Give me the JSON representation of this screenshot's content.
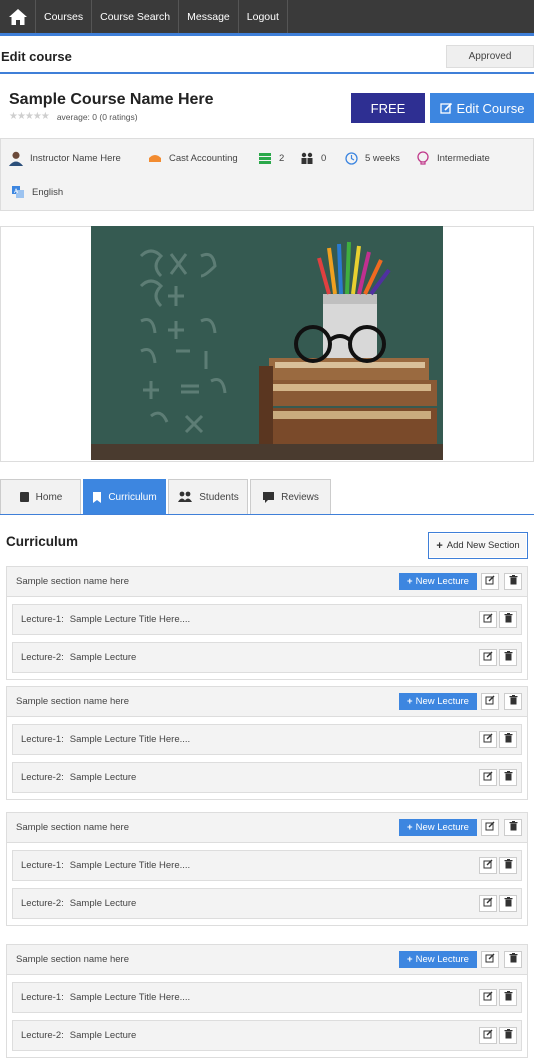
{
  "nav": {
    "home_icon": "home-icon",
    "items": [
      "Courses",
      "Course Search",
      "Message",
      "Logout"
    ]
  },
  "header": {
    "title": "Edit course",
    "status": "Approved"
  },
  "course": {
    "title": "Sample Course Name Here",
    "rating_text": "average: 0 (0 ratings)",
    "rating_value": 0,
    "free_label": "FREE",
    "edit_label": "Edit Course"
  },
  "meta": {
    "instructor": "Instructor Name Here",
    "category": "Cast Accounting",
    "lessons": "2",
    "students": "0",
    "duration": "5 weeks",
    "level": "Intermediate",
    "language": "English"
  },
  "tabs": [
    "Home",
    "Curriculum",
    "Students",
    "Reviews"
  ],
  "curriculum": {
    "title": "Curriculum",
    "add_section_label": "Add New Section",
    "new_lecture_label": "New Lecture",
    "sections": [
      {
        "name": "Sample section name here",
        "lectures": [
          {
            "num": "Lecture-1:",
            "title": "Sample Lecture Title Here...."
          },
          {
            "num": "Lecture-2:",
            "title": "Sample Lecture"
          }
        ]
      },
      {
        "name": "Sample section name here",
        "lectures": [
          {
            "num": "Lecture-1:",
            "title": "Sample Lecture Title Here...."
          },
          {
            "num": "Lecture-2:",
            "title": "Sample Lecture"
          }
        ]
      },
      {
        "name": "Sample section name here",
        "lectures": [
          {
            "num": "Lecture-1:",
            "title": "Sample Lecture Title Here...."
          },
          {
            "num": "Lecture-2:",
            "title": "Sample Lecture"
          }
        ]
      },
      {
        "name": "Sample section name here",
        "lectures": [
          {
            "num": "Lecture-1:",
            "title": "Sample Lecture Title Here...."
          },
          {
            "num": "Lecture-2:",
            "title": "Sample Lecture"
          }
        ]
      }
    ]
  },
  "colors": {
    "primary": "#3d86e0",
    "free": "#2e2f92",
    "nav": "#3a3a3a"
  }
}
